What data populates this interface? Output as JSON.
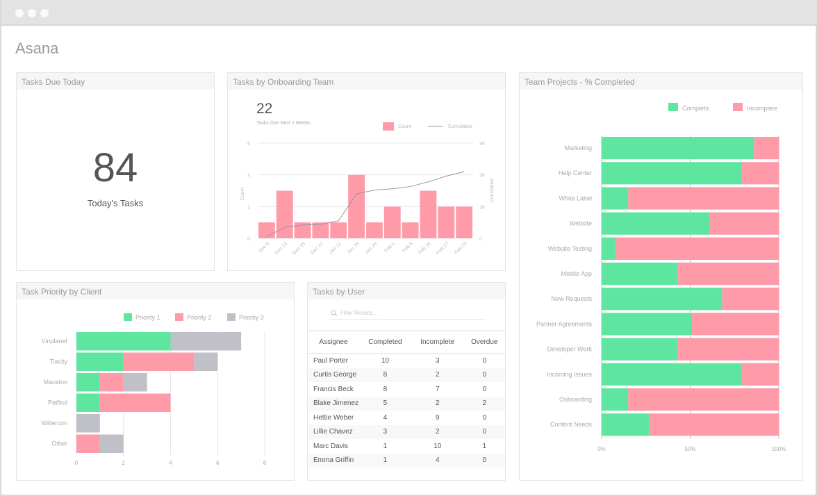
{
  "app": {
    "title": "Asana"
  },
  "colors": {
    "pink": "#ff9aa8",
    "green": "#5ee6a0",
    "gray": "#c0c0c8",
    "line": "#999999"
  },
  "tasks_due_today": {
    "title": "Tasks Due Today",
    "value": "84",
    "label": "Today's Tasks"
  },
  "onboarding": {
    "title": "Tasks by Onboarding Team",
    "value": "22",
    "subtitle": "Tasks Due Next 2 Weeks"
  },
  "priority": {
    "title": "Task Priority by Client"
  },
  "users": {
    "title": "Tasks by User",
    "search_placeholder": "Filter Results...",
    "columns": [
      "Assignee",
      "Completed",
      "Incomplete",
      "Overdue"
    ],
    "rows": [
      [
        "Paul Porter",
        "10",
        "3",
        "0"
      ],
      [
        "Curtis George",
        "8",
        "2",
        "0"
      ],
      [
        "Francis Beck",
        "8",
        "7",
        "0"
      ],
      [
        "Blake Jimenez",
        "5",
        "2",
        "2"
      ],
      [
        "Hettie Weber",
        "4",
        "9",
        "0"
      ],
      [
        "Lillie Chavez",
        "3",
        "2",
        "0"
      ],
      [
        "Marc Davis",
        "1",
        "10",
        "1"
      ],
      [
        "Emma Griffin",
        "1",
        "4",
        "0"
      ]
    ]
  },
  "projects": {
    "title": "Team Projects - % Completed"
  },
  "chart_data": [
    {
      "type": "bar",
      "title": "Tasks by Onboarding Team",
      "categories": [
        "Dec 9",
        "Dec 14",
        "Dec 15",
        "Dec 21",
        "Jan 12",
        "Jan 18",
        "Jan 24",
        "Feb 1",
        "Feb 8",
        "Feb 16",
        "Feb 17",
        "Feb 23"
      ],
      "series": [
        {
          "name": "Count",
          "type": "bar",
          "axis": "left",
          "values": [
            1,
            3,
            1,
            1,
            1,
            4,
            1,
            2,
            1,
            3,
            2,
            2
          ]
        },
        {
          "name": "Cumulative",
          "type": "line",
          "axis": "right",
          "values": [
            0.5,
            3.5,
            4.2,
            4.4,
            5.5,
            14,
            15.2,
            15.6,
            16.3,
            17.8,
            19.6,
            21
          ]
        }
      ],
      "ylabel": "Count",
      "y2label": "Cumulative",
      "ylim": [
        0,
        6
      ],
      "y2lim": [
        0,
        30
      ],
      "yticks": [
        0,
        2,
        4,
        6
      ],
      "y2ticks": [
        0,
        10,
        20,
        30
      ],
      "legend": "top-right",
      "grid": true
    },
    {
      "type": "bar",
      "orientation": "horizontal",
      "stacked": true,
      "title": "Task Priority by Client",
      "categories": [
        "Vinplanet",
        "Tiacity",
        "Maceton",
        "Patfind",
        "Wiltercon",
        "Other"
      ],
      "series": [
        {
          "name": "Priority 1",
          "values": [
            4,
            2,
            1,
            1,
            0,
            0
          ]
        },
        {
          "name": "Priority 2",
          "values": [
            0,
            3,
            1,
            3,
            0,
            1
          ]
        },
        {
          "name": "Priority 3",
          "values": [
            3,
            1,
            1,
            0,
            1,
            1
          ]
        }
      ],
      "xlim": [
        0,
        8
      ],
      "xticks": [
        0,
        2,
        4,
        6,
        8
      ],
      "legend": "top",
      "grid": true
    },
    {
      "type": "bar",
      "orientation": "horizontal",
      "stacked": true,
      "title": "Team Projects - % Completed",
      "categories": [
        "Marketing",
        "Help Center",
        "White Label",
        "Website",
        "Website Testing",
        "Mobile App",
        "New Requests",
        "Partner Agreements",
        "Developer Work",
        "Incoming Issues",
        "Onboarding",
        "Content Needs"
      ],
      "series": [
        {
          "name": "Complete",
          "values": [
            86,
            79,
            15,
            61,
            8,
            43,
            68,
            51,
            43,
            79,
            15,
            27
          ]
        },
        {
          "name": "Incomplete",
          "values": [
            14,
            21,
            85,
            39,
            92,
            57,
            32,
            49,
            57,
            21,
            85,
            73
          ]
        }
      ],
      "xlim": [
        0,
        100
      ],
      "xticks": [
        "0%",
        "50%",
        "100%"
      ],
      "legend": "top-right",
      "grid": true
    }
  ]
}
